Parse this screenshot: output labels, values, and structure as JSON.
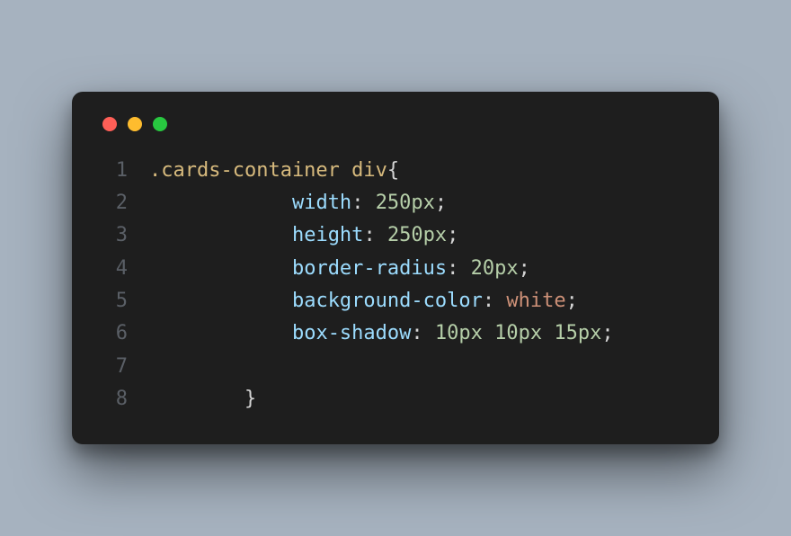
{
  "traffic_lights": {
    "close": "#ff5f57",
    "minimize": "#febc2e",
    "zoom": "#28c840"
  },
  "code": {
    "line_numbers": [
      "1",
      "2",
      "3",
      "4",
      "5",
      "6",
      "7",
      "8"
    ],
    "indent1": "        ",
    "indent2": "            ",
    "selector_class": ".cards-container",
    "space": " ",
    "selector_tag": "div",
    "brace_open": "{",
    "brace_close": "}",
    "colon": ":",
    "semicolon": ";",
    "rules": [
      {
        "prop": "width",
        "vals": [
          "250px"
        ]
      },
      {
        "prop": "height",
        "vals": [
          "250px"
        ]
      },
      {
        "prop": "border-radius",
        "vals": [
          "20px"
        ]
      },
      {
        "prop": "background-color",
        "vals": [
          "white"
        ],
        "const": true
      },
      {
        "prop": "box-shadow",
        "vals": [
          "10px",
          "10px",
          "15px"
        ]
      }
    ]
  }
}
